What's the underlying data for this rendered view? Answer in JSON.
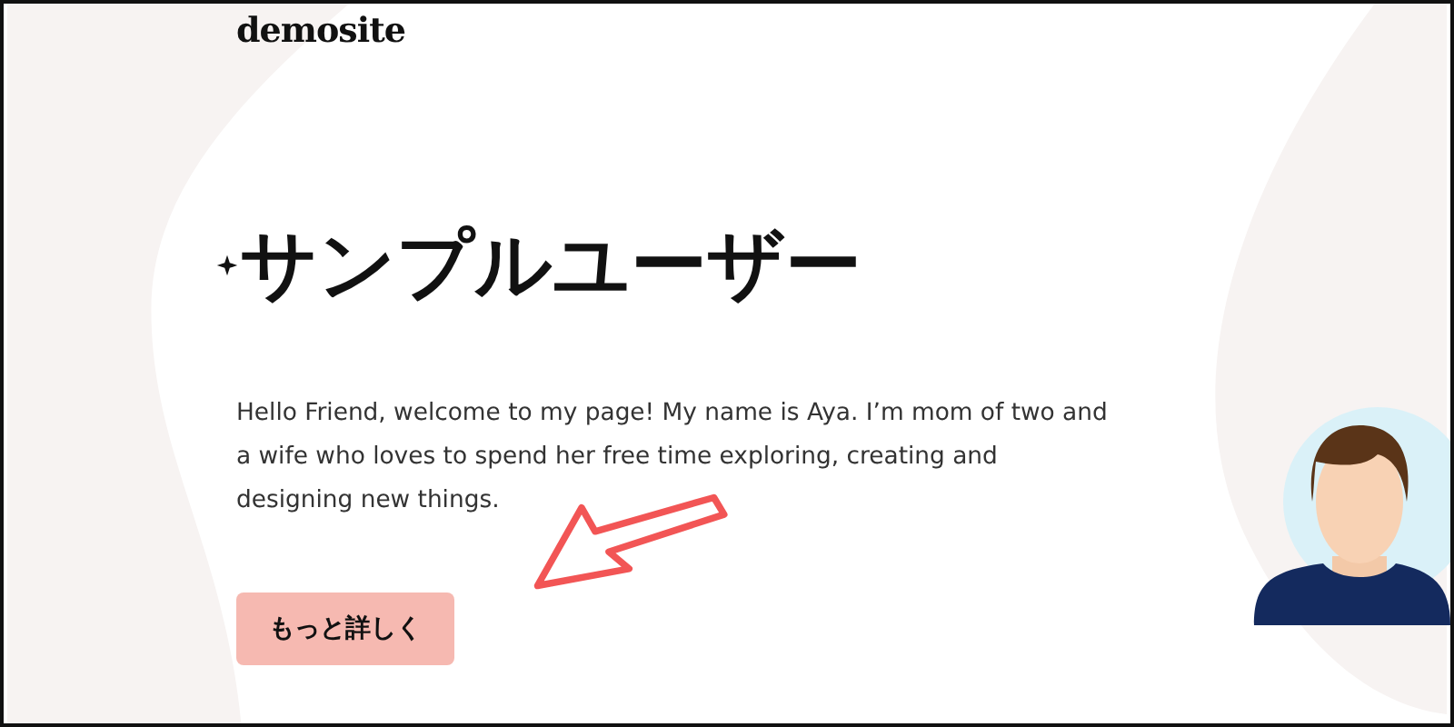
{
  "logo": "demosite",
  "hero": {
    "title": "サンプルユーザー",
    "intro": "Hello Friend, welcome to my page! My name is Aya. I’m mom of two and a wife who loves to spend her free time exploring, creating and designing new things.",
    "button": "もっと詳しく"
  }
}
